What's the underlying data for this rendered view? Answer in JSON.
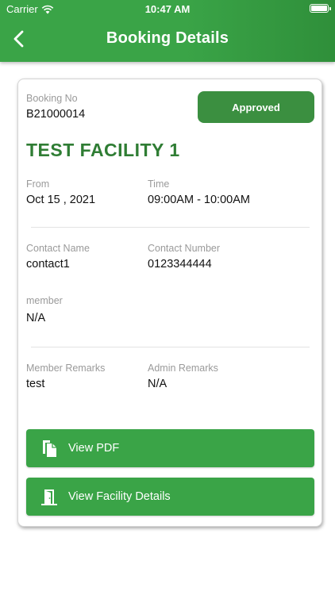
{
  "status_bar": {
    "carrier": "Carrier",
    "time": "10:47 AM"
  },
  "header": {
    "title": "Booking Details"
  },
  "booking": {
    "no_label": "Booking No",
    "no_value": "B21000014",
    "status": "Approved",
    "facility": "TEST FACILITY 1",
    "from_label": "From",
    "from_value": "Oct 15 , 2021",
    "time_label": "Time",
    "time_value": "09:00AM - 10:00AM",
    "contact_name_label": "Contact Name",
    "contact_name_value": "contact1",
    "contact_number_label": "Contact Number",
    "contact_number_value": "0123344444",
    "member_label": "member",
    "member_value": "N/A",
    "member_remarks_label": "Member Remarks",
    "member_remarks_value": "test",
    "admin_remarks_label": "Admin Remarks",
    "admin_remarks_value": "N/A"
  },
  "actions": {
    "view_pdf": {
      "label": "View PDF",
      "icon": "document-copy-icon"
    },
    "view_facility": {
      "label": "View Facility Details",
      "icon": "door-open-icon"
    }
  },
  "colors": {
    "primary": "#3aa447",
    "badge": "#3b8f40",
    "facility_text": "#2f7d34"
  }
}
